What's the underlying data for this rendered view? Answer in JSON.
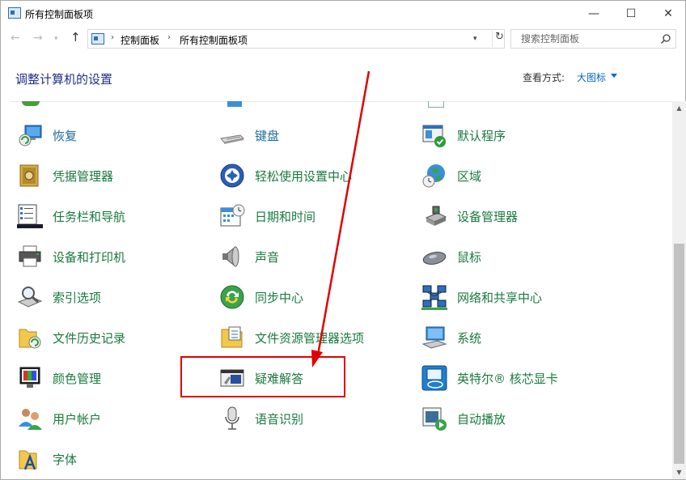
{
  "window": {
    "title": "所有控制面板项",
    "minimize_glyph": "—",
    "maximize_glyph": "☐",
    "close_glyph": "✕"
  },
  "nav": {
    "back_glyph": "←",
    "forward_glyph": "→",
    "history_glyph": "▾",
    "up_glyph": "↑"
  },
  "address": {
    "sep_glyph": "›",
    "breadcrumb": [
      "控制面板",
      "所有控制面板项"
    ],
    "dropdown_glyph": "▾",
    "refresh_glyph": "↻"
  },
  "search": {
    "placeholder": "搜索控制面板"
  },
  "header": {
    "title": "调整计算机的设置",
    "view_by_label": "查看方式:",
    "view_by_value": "大图标"
  },
  "items": [
    {
      "label": "恢复",
      "icon": "recovery-icon"
    },
    {
      "label": "键盘",
      "icon": "keyboard-icon"
    },
    {
      "label": "默认程序",
      "icon": "default-programs-icon"
    },
    {
      "label": "凭据管理器",
      "icon": "credential-manager-icon"
    },
    {
      "label": "轻松使用设置中心",
      "icon": "ease-of-access-icon"
    },
    {
      "label": "区域",
      "icon": "region-icon"
    },
    {
      "label": "任务栏和导航",
      "icon": "taskbar-icon"
    },
    {
      "label": "日期和时间",
      "icon": "date-time-icon"
    },
    {
      "label": "设备管理器",
      "icon": "device-manager-icon"
    },
    {
      "label": "设备和打印机",
      "icon": "devices-printers-icon"
    },
    {
      "label": "声音",
      "icon": "sound-icon"
    },
    {
      "label": "鼠标",
      "icon": "mouse-icon"
    },
    {
      "label": "索引选项",
      "icon": "indexing-icon"
    },
    {
      "label": "同步中心",
      "icon": "sync-center-icon"
    },
    {
      "label": "网络和共享中心",
      "icon": "network-icon"
    },
    {
      "label": "文件历史记录",
      "icon": "file-history-icon"
    },
    {
      "label": "文件资源管理器选项",
      "icon": "folder-options-icon"
    },
    {
      "label": "系统",
      "icon": "system-icon"
    },
    {
      "label": "颜色管理",
      "icon": "color-management-icon"
    },
    {
      "label": "疑难解答",
      "icon": "troubleshooting-icon"
    },
    {
      "label": "英特尔® 核芯显卡",
      "icon": "intel-graphics-icon"
    },
    {
      "label": "用户帐户",
      "icon": "user-accounts-icon"
    },
    {
      "label": "语音识别",
      "icon": "speech-icon"
    },
    {
      "label": "自动播放",
      "icon": "autoplay-icon"
    },
    {
      "label": "字体",
      "icon": "fonts-icon"
    }
  ],
  "scrollbar": {
    "up_glyph": "▲",
    "down_glyph": "▼"
  },
  "colors": {
    "link_blue": "#1d6b9f",
    "title_blue": "#1e3287",
    "annotation_red": "#e00000"
  }
}
